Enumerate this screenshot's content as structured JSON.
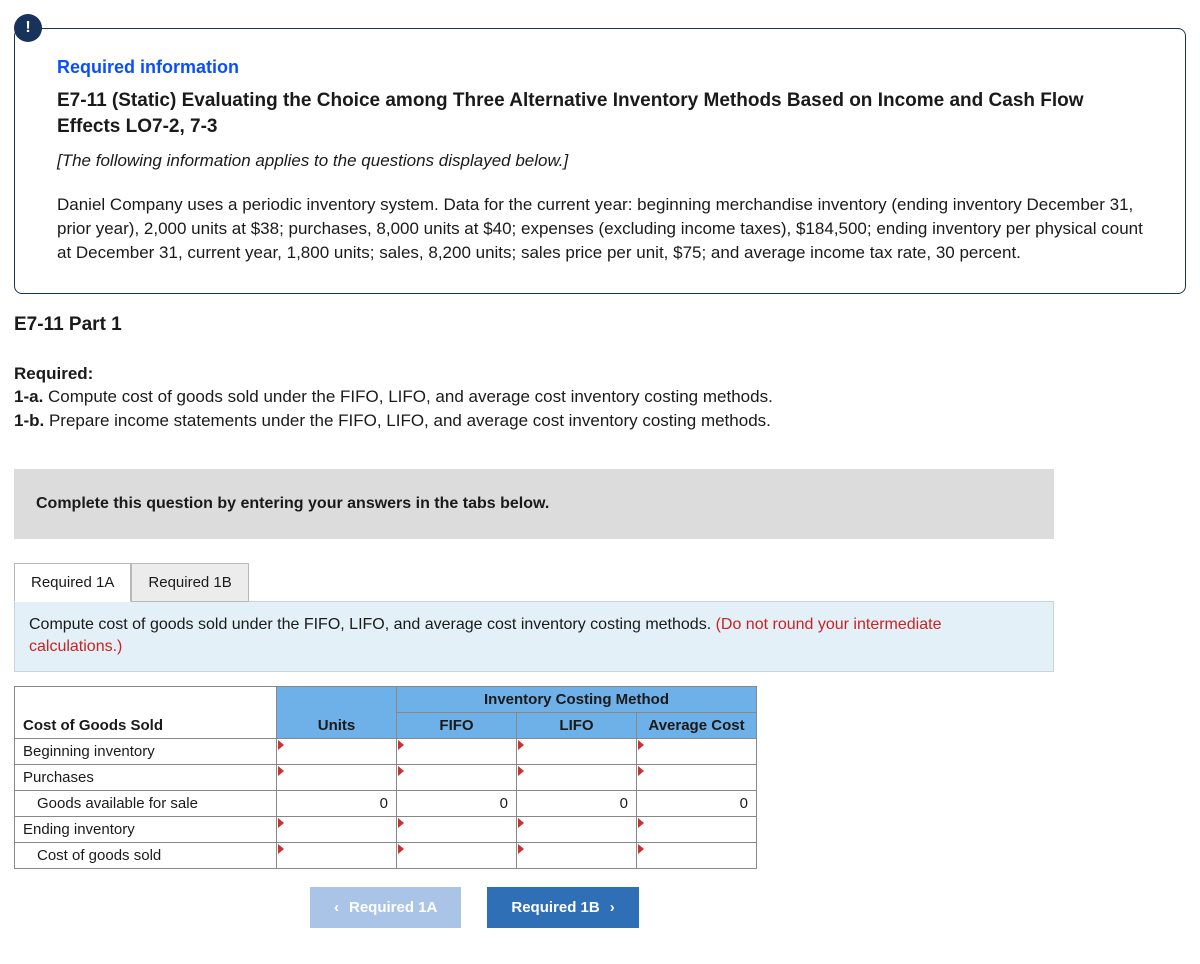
{
  "badge_icon": "!",
  "info": {
    "required_heading": "Required information",
    "title": "E7-11 (Static) Evaluating the Choice among Three Alternative Inventory Methods Based on Income and Cash Flow Effects LO7-2, 7-3",
    "italic_note": "[The following information applies to the questions displayed below.]",
    "paragraph": "Daniel Company uses a periodic inventory system. Data for the current year: beginning merchandise inventory (ending inventory December 31, prior year), 2,000 units at $38; purchases, 8,000 units at $40; expenses (excluding income taxes), $184,500; ending inventory per physical count at December 31, current year, 1,800 units; sales, 8,200 units; sales price per unit, $75; and average income tax rate, 30 percent."
  },
  "part_title": "E7-11 Part 1",
  "required": {
    "label": "Required:",
    "a_label": "1-a.",
    "a_text": " Compute cost of goods sold under the FIFO, LIFO, and average cost inventory costing methods.",
    "b_label": "1-b.",
    "b_text": " Prepare income statements under the FIFO, LIFO, and average cost inventory costing methods."
  },
  "gray_instruction": "Complete this question by entering your answers in the tabs below.",
  "tabs": {
    "tab1": "Required 1A",
    "tab2": "Required 1B"
  },
  "prompt": {
    "text": "Compute cost of goods sold under the FIFO, LIFO, and average cost inventory costing methods. ",
    "red": "(Do not round your intermediate calculations.)"
  },
  "table": {
    "span_header": "Inventory Costing Method",
    "h_cogs": "Cost of Goods Sold",
    "h_units": "Units",
    "h_fifo": "FIFO",
    "h_lifo": "LIFO",
    "h_avg": "Average Cost",
    "rows": {
      "r1": "Beginning inventory",
      "r2": "Purchases",
      "r3": "Goods available for sale",
      "r4": "Ending inventory",
      "r5": "Cost of goods sold"
    },
    "calc": {
      "gafs_units": "0",
      "gafs_fifo": "0",
      "gafs_lifo": "0",
      "gafs_avg": "0"
    }
  },
  "nav": {
    "prev": "Required 1A",
    "next": "Required 1B"
  }
}
